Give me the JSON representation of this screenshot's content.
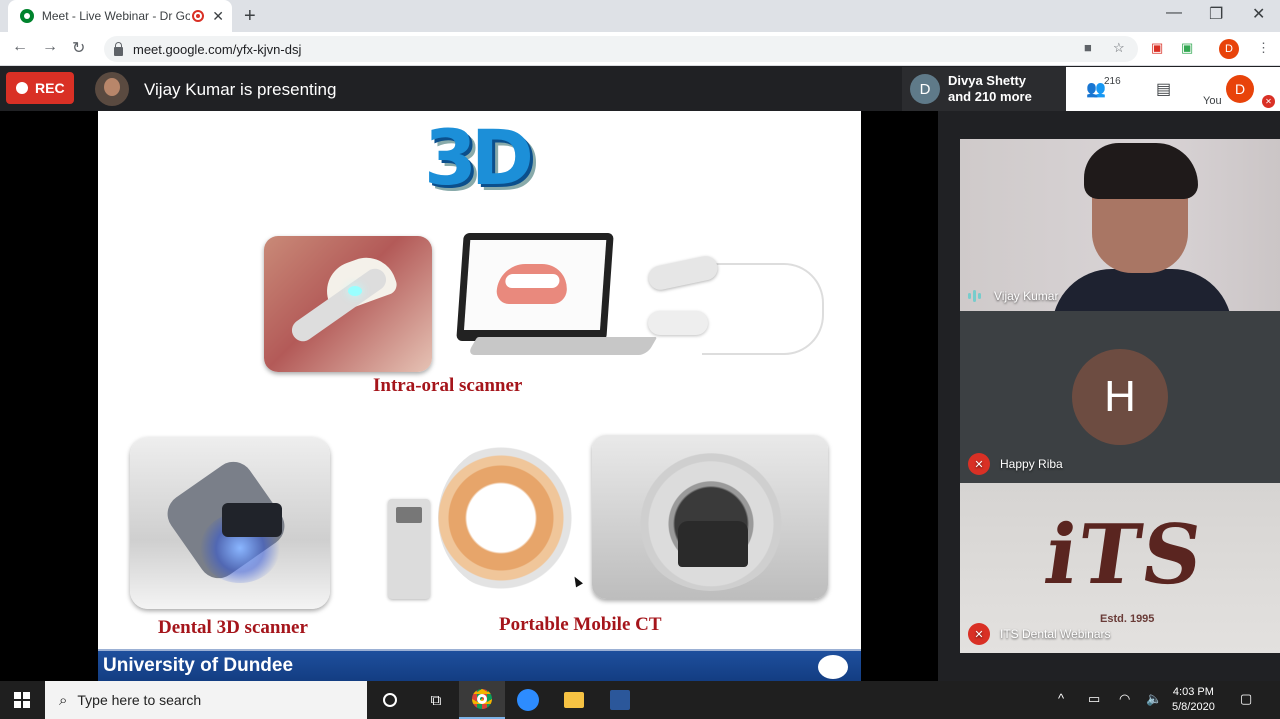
{
  "browser": {
    "tab_title": "Meet - Live Webinar - Dr Go",
    "url": "meet.google.com/yfx-kjvn-dsj",
    "profile_initial": "D"
  },
  "meet": {
    "rec_label": "REC",
    "presenting_text": "Vijay Kumar is presenting",
    "others_initial": "D",
    "others_line1": "Divya Shetty",
    "others_line2": "and 210 more",
    "participant_count": "216",
    "you_label": "You",
    "you_initial": "D"
  },
  "slide": {
    "logo_text": "3D",
    "caption_intraoral": "Intra-oral scanner",
    "caption_dental": "Dental 3D scanner",
    "caption_ct": "Portable Mobile CT",
    "footer_text": "University of Dundee"
  },
  "tiles": [
    {
      "name": "Vijay Kumar",
      "status": "speaking"
    },
    {
      "name": "Happy Riba",
      "initial": "H",
      "status": "muted"
    },
    {
      "name": "ITS Dental Webinars",
      "status": "muted",
      "logo_text": "iTS",
      "logo_sub": "Estd. 1995"
    }
  ],
  "taskbar": {
    "search_placeholder": "Type here to search",
    "time": "4:03 PM",
    "date": "5/8/2020"
  },
  "colors": {
    "rec_red": "#d93025",
    "caption_red": "#a5151b",
    "footer_blue": "#1e4f9d",
    "avatar_orange": "#e8430a",
    "avatar_brown": "#6d4c41"
  }
}
